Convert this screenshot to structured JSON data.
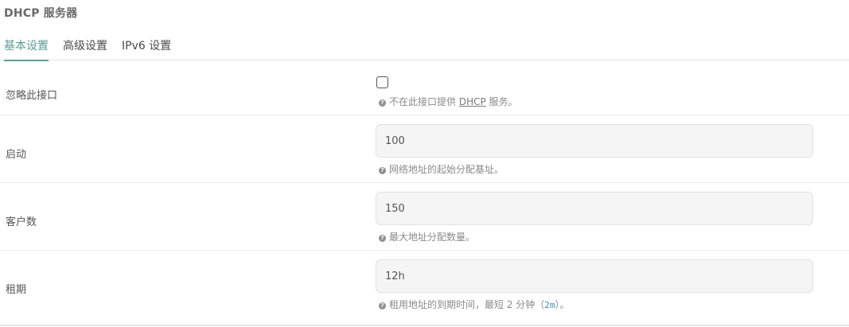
{
  "section": {
    "title": "DHCP 服务器"
  },
  "tabs": [
    {
      "label": "基本设置",
      "active": true
    },
    {
      "label": "高级设置",
      "active": false
    },
    {
      "label": "IPv6 设置",
      "active": false
    }
  ],
  "fields": {
    "ignore": {
      "label": "忽略此接口",
      "checked": false,
      "hint_prefix": "不在此接口提供 ",
      "hint_abbr": "DHCP",
      "hint_suffix": " 服务。"
    },
    "start": {
      "label": "启动",
      "value": "100",
      "hint": "网络地址的起始分配基址。"
    },
    "limit": {
      "label": "客户数",
      "value": "150",
      "hint": "最大地址分配数量。"
    },
    "leasetime": {
      "label": "租期",
      "value": "12h",
      "hint_prefix": "租用地址的到期时间，最短 2 分钟（",
      "hint_code": "2m",
      "hint_suffix": "）。"
    }
  },
  "colors": {
    "accent": "#5b9c94",
    "input_bg": "#f5f5f5",
    "hint_text": "#8a8a8a"
  },
  "icons": {
    "hint": "question-circle-icon"
  }
}
